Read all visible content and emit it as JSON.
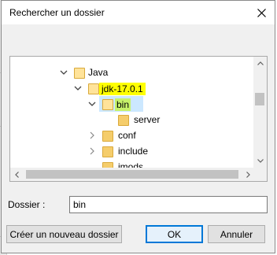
{
  "dialog": {
    "title": "Rechercher un dossier",
    "close_icon": "close-icon"
  },
  "tree": {
    "items": [
      {
        "label": "Java",
        "expanded": true
      },
      {
        "label": "jdk-17.0.1",
        "expanded": true,
        "highlight": "#ffff00"
      },
      {
        "label": "bin",
        "expanded": true,
        "selected": true,
        "highlight": "#c7f26a"
      },
      {
        "label": "server"
      },
      {
        "label": "conf",
        "expanded": false
      },
      {
        "label": "include",
        "expanded": false
      },
      {
        "label": "jmods"
      }
    ]
  },
  "folder_field": {
    "label": "Dossier :",
    "value": "bin"
  },
  "buttons": {
    "new_folder": "Créer un nouveau dossier",
    "ok": "OK",
    "cancel": "Annuler"
  },
  "colors": {
    "accent": "#0078d7",
    "selection": "#cce8ff",
    "folder": "#f5cd6b"
  }
}
